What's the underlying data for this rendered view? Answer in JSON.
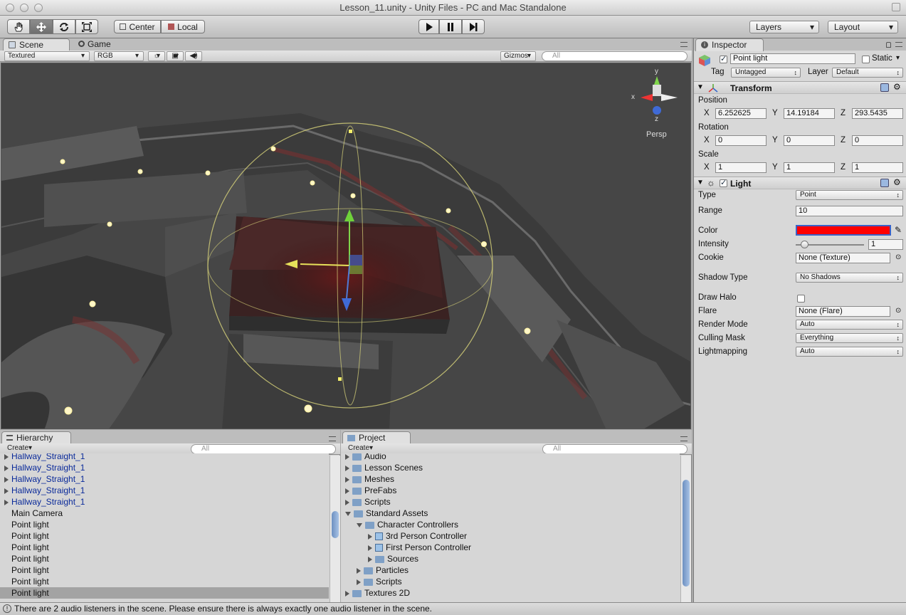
{
  "window": {
    "title": "Lesson_11.unity - Unity Files - PC and Mac Standalone"
  },
  "toolbar": {
    "pivot_label": "Center",
    "space_label": "Local",
    "layers_label": "Layers",
    "layout_label": "Layout"
  },
  "scene_panel": {
    "tabs": [
      "Scene",
      "Game"
    ],
    "draw_mode": "Textured",
    "render_mode": "RGB",
    "gizmos_label": "Gizmos",
    "search_placeholder": "All",
    "view_label": "Persp",
    "axis_labels": {
      "x": "x",
      "y": "y",
      "z": "z"
    }
  },
  "hierarchy": {
    "tab": "Hierarchy",
    "create_label": "Create",
    "search_placeholder": "All",
    "items": [
      {
        "label": "Hallway_Straight_1",
        "prefab": true,
        "expandable": true
      },
      {
        "label": "Hallway_Straight_1",
        "prefab": true,
        "expandable": true
      },
      {
        "label": "Hallway_Straight_1",
        "prefab": true,
        "expandable": true
      },
      {
        "label": "Hallway_Straight_1",
        "prefab": true,
        "expandable": true
      },
      {
        "label": "Hallway_Straight_1",
        "prefab": true,
        "expandable": true
      },
      {
        "label": "Main Camera",
        "prefab": false,
        "expandable": false
      },
      {
        "label": "Point light",
        "prefab": false,
        "expandable": false
      },
      {
        "label": "Point light",
        "prefab": false,
        "expandable": false
      },
      {
        "label": "Point light",
        "prefab": false,
        "expandable": false
      },
      {
        "label": "Point light",
        "prefab": false,
        "expandable": false
      },
      {
        "label": "Point light",
        "prefab": false,
        "expandable": false
      },
      {
        "label": "Point light",
        "prefab": false,
        "expandable": false
      },
      {
        "label": "Point light",
        "prefab": false,
        "expandable": false,
        "selected": true
      }
    ]
  },
  "project": {
    "tab": "Project",
    "create_label": "Create",
    "search_placeholder": "All",
    "items": [
      {
        "label": "Audio",
        "depth": 0,
        "kind": "folder",
        "state": "closed"
      },
      {
        "label": "Lesson Scenes",
        "depth": 0,
        "kind": "folder",
        "state": "closed"
      },
      {
        "label": "Meshes",
        "depth": 0,
        "kind": "folder",
        "state": "closed"
      },
      {
        "label": "PreFabs",
        "depth": 0,
        "kind": "folder",
        "state": "closed"
      },
      {
        "label": "Scripts",
        "depth": 0,
        "kind": "folder",
        "state": "closed"
      },
      {
        "label": "Standard Assets",
        "depth": 0,
        "kind": "folder",
        "state": "open"
      },
      {
        "label": "Character Controllers",
        "depth": 1,
        "kind": "folder",
        "state": "open"
      },
      {
        "label": "3rd Person Controller",
        "depth": 2,
        "kind": "prefab",
        "state": "closed"
      },
      {
        "label": "First Person Controller",
        "depth": 2,
        "kind": "prefab",
        "state": "closed"
      },
      {
        "label": "Sources",
        "depth": 2,
        "kind": "folder",
        "state": "closed"
      },
      {
        "label": "Particles",
        "depth": 1,
        "kind": "folder",
        "state": "closed"
      },
      {
        "label": "Scripts",
        "depth": 1,
        "kind": "folder",
        "state": "closed"
      },
      {
        "label": "Textures 2D",
        "depth": 0,
        "kind": "folder",
        "state": "closed"
      }
    ]
  },
  "inspector": {
    "tab": "Inspector",
    "object_name": "Point light",
    "static_label": "Static",
    "tag_label": "Tag",
    "tag_value": "Untagged",
    "layer_label": "Layer",
    "layer_value": "Default",
    "transform": {
      "title": "Transform",
      "position_label": "Position",
      "rotation_label": "Rotation",
      "scale_label": "Scale",
      "axis_x": "X",
      "axis_y": "Y",
      "axis_z": "Z",
      "position": {
        "x": "6.252625",
        "y": "14.19184",
        "z": "293.5435"
      },
      "rotation": {
        "x": "0",
        "y": "0",
        "z": "0"
      },
      "scale": {
        "x": "1",
        "y": "1",
        "z": "1"
      }
    },
    "light": {
      "title": "Light",
      "type_label": "Type",
      "type_value": "Point",
      "range_label": "Range",
      "range_value": "10",
      "color_label": "Color",
      "color_value": "#ff0000",
      "intensity_label": "Intensity",
      "intensity_value": "1",
      "intensity_fraction": 0.125,
      "cookie_label": "Cookie",
      "cookie_value": "None (Texture)",
      "shadow_label": "Shadow Type",
      "shadow_value": "No Shadows",
      "halo_label": "Draw Halo",
      "flare_label": "Flare",
      "flare_value": "None (Flare)",
      "render_mode_label": "Render Mode",
      "render_mode_value": "Auto",
      "culling_label": "Culling Mask",
      "culling_value": "Everything",
      "lightmapping_label": "Lightmapping",
      "lightmapping_value": "Auto"
    }
  },
  "status": {
    "message": "There are 2 audio listeners in the scene. Please ensure there is always exactly one audio listener in the scene."
  }
}
